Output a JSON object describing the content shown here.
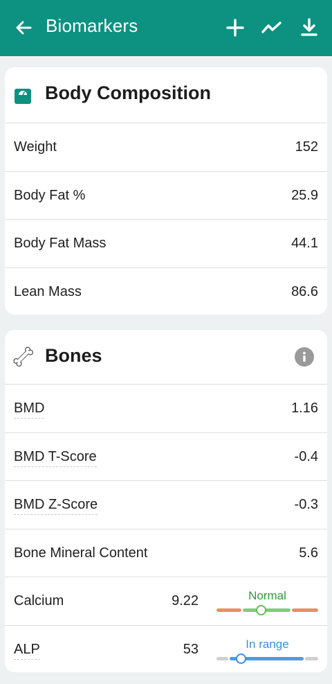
{
  "appbar": {
    "title": "Biomarkers",
    "color": "#0d9181",
    "icons": [
      "back-arrow-icon",
      "plus-icon",
      "trend-chart-icon",
      "download-icon"
    ]
  },
  "body_composition": {
    "title": "Body Composition",
    "icon": "scale-icon",
    "rows": [
      {
        "label": "Weight",
        "value": "152"
      },
      {
        "label": "Body Fat %",
        "value": "25.9"
      },
      {
        "label": "Body Fat Mass",
        "value": "44.1"
      },
      {
        "label": "Lean Mass",
        "value": "86.6"
      }
    ]
  },
  "bones": {
    "title": "Bones",
    "icon": "bone-icon",
    "info_icon": "info-icon",
    "rows": [
      {
        "label": "BMD",
        "value": "1.16"
      },
      {
        "label": "BMD T-Score",
        "value": "-0.4"
      },
      {
        "label": "BMD Z-Score",
        "value": "-0.3"
      },
      {
        "label": "Bone Mineral Content",
        "value": "5.6"
      },
      {
        "label": "Calcium",
        "value": "9.22",
        "status": "Normal",
        "status_color": "#2e9a3a",
        "marker_fraction": 0.44
      },
      {
        "label": "ALP",
        "value": "53",
        "status": "In range",
        "status_color": "#3a8fe0",
        "marker_fraction": 0.24
      }
    ]
  }
}
